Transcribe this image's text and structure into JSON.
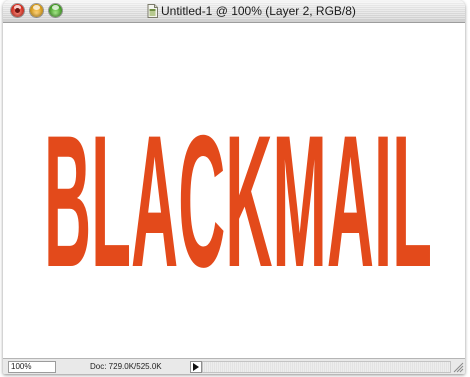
{
  "window": {
    "title": "Untitled-1 @ 100% (Layer 2, RGB/8)"
  },
  "canvas": {
    "headline": "BLACKMAIL",
    "headline_color": "#e34a1b",
    "background_color": "#ffffff"
  },
  "statusbar": {
    "zoom": "100%",
    "doc_info": "Doc: 729.0K/525.0K"
  },
  "icons": {
    "close": "close-icon",
    "minimize": "minimize-icon",
    "zoom": "zoom-icon",
    "document": "document-proxy-icon",
    "menu_arrow": "triangle-right-icon",
    "resize": "resize-grip-icon"
  }
}
